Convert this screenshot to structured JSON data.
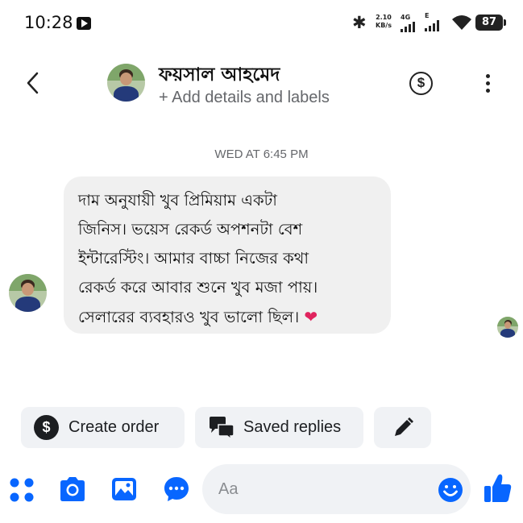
{
  "status_bar": {
    "time": "10:28",
    "speed_value": "2.10",
    "speed_unit": "KB/s",
    "network_1": "4G",
    "network_2": "E",
    "battery": "87"
  },
  "header": {
    "contact_name": "ফয়সাল আহমেদ",
    "add_details": "+ Add details and labels"
  },
  "conversation": {
    "timestamp": "WED AT 6:45 PM",
    "message": {
      "lines": [
        "দাম অনুযায়ী খুব প্রিমিয়াম একটা",
        "জিনিস। ভয়েস রেকর্ড অপশনটা বেশ",
        "ইন্টারেস্টিং। আমার বাচ্চা নিজের কথা",
        "রেকর্ড করে আবার শুনে খুব মজা পায়।",
        "সেলারের ব্যবহারও খুব ভালো ছিল।"
      ],
      "emoji": "heart"
    }
  },
  "quick_actions": {
    "create_order": "Create order",
    "saved_replies": "Saved replies"
  },
  "composer": {
    "placeholder": "Aa"
  },
  "colors": {
    "accent": "#0866ff",
    "bubble": "#f0f0f0",
    "chip": "#f0f2f5",
    "heart": "#e0245e",
    "muted_text": "#65676b"
  },
  "icons": {
    "back": "chevron-left-icon",
    "payment": "dollar-circle-icon",
    "more": "vertical-dots-icon",
    "edit": "pencil-icon",
    "apps": "four-dots-icon",
    "camera": "camera-icon",
    "gallery": "image-icon",
    "chat": "chat-bubble-icon",
    "emoji": "smiley-icon",
    "like": "thumbs-up-icon"
  }
}
